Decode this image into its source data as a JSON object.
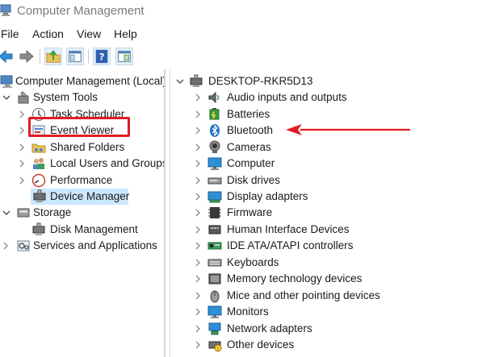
{
  "window": {
    "title": "Computer Management"
  },
  "menu": [
    "File",
    "Action",
    "View",
    "Help"
  ],
  "toolbar": {
    "icons": [
      "back-arrow-icon",
      "forward-arrow-icon",
      "up-folder-icon",
      "show-hide-tree-icon",
      "help-icon",
      "properties-icon"
    ]
  },
  "left_tree": {
    "root": "Computer Management (Local)",
    "system_tools": "System Tools",
    "task_scheduler": "Task Scheduler",
    "event_viewer": "Event Viewer",
    "shared_folders": "Shared Folders",
    "local_users": "Local Users and Groups",
    "performance": "Performance",
    "device_manager": "Device Manager",
    "storage": "Storage",
    "disk_management": "Disk Management",
    "services": "Services and Applications"
  },
  "right_tree": {
    "computer_name": "DESKTOP-RKR5D13",
    "categories": [
      "Audio inputs and outputs",
      "Batteries",
      "Bluetooth",
      "Cameras",
      "Computer",
      "Disk drives",
      "Display adapters",
      "Firmware",
      "Human Interface Devices",
      "IDE ATA/ATAPI controllers",
      "Keyboards",
      "Memory technology devices",
      "Mice and other pointing devices",
      "Monitors",
      "Network adapters",
      "Other devices"
    ]
  },
  "colors": {
    "annotation_red": "#e01b24",
    "selected_bg": "#cce8ff",
    "accent_blue": "#1a73c9"
  }
}
